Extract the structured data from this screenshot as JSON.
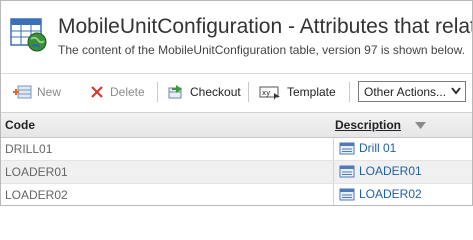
{
  "header": {
    "title": "MobileUnitConfiguration - Attributes that relate",
    "subtitle": "The content of the MobileUnitConfiguration table, version 97 is shown below.",
    "icon": "table-globe-icon"
  },
  "toolbar": {
    "new_label": "New",
    "delete_label": "Delete",
    "checkout_label": "Checkout",
    "template_label": "Template",
    "other_actions_label": "Other Actions..."
  },
  "table": {
    "columns": {
      "code": "Code",
      "description": "Description"
    },
    "rows": [
      {
        "code": "DRILL01",
        "description": "Drill 01"
      },
      {
        "code": "LOADER01",
        "description": "LOADER01"
      },
      {
        "code": "LOADER02",
        "description": "LOADER02"
      }
    ]
  },
  "colors": {
    "link": "#1f5fae",
    "disabled_text": "#8a8a8a",
    "delete_icon": "#d83a2e"
  }
}
